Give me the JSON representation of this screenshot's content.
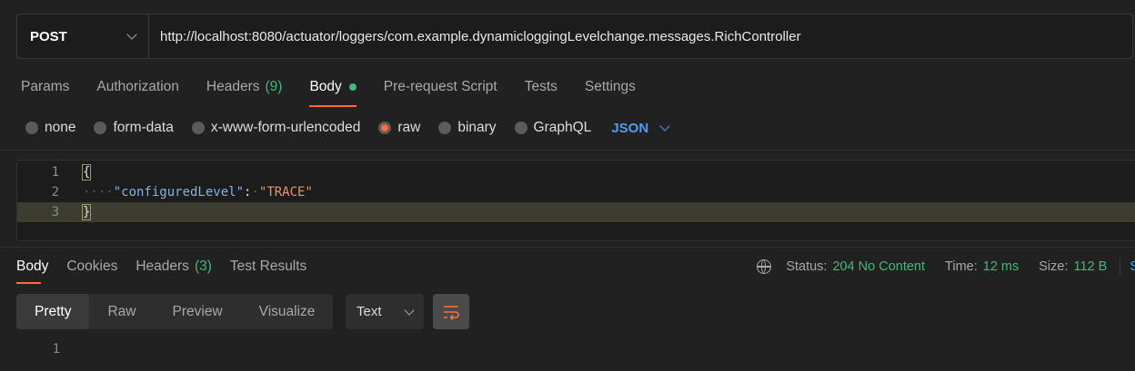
{
  "request": {
    "method": "POST",
    "url": "http://localhost:8080/actuator/loggers/com.example.dynamicloggingLevelchange.messages.RichController"
  },
  "request_tabs": [
    {
      "label": "Params"
    },
    {
      "label": "Authorization"
    },
    {
      "label": "Headers",
      "count": "(9)"
    },
    {
      "label": "Body",
      "active": true
    },
    {
      "label": "Pre-request Script"
    },
    {
      "label": "Tests"
    },
    {
      "label": "Settings"
    }
  ],
  "body_types": [
    "none",
    "form-data",
    "x-www-form-urlencoded",
    "raw",
    "binary",
    "GraphQL"
  ],
  "body_language": "JSON",
  "editor": {
    "lines": [
      {
        "num": "1",
        "text": "{"
      },
      {
        "num": "2",
        "key": "\"configuredLevel\"",
        "colon": ":",
        "value": "\"TRACE\""
      },
      {
        "num": "3",
        "text": "}"
      }
    ]
  },
  "response_tabs": [
    {
      "label": "Body"
    },
    {
      "label": "Cookies"
    },
    {
      "label": "Headers",
      "count": "(3)"
    },
    {
      "label": "Test Results"
    }
  ],
  "status": {
    "status_label": "Status:",
    "status_value": "204 No Content",
    "time_label": "Time:",
    "time_value": "12 ms",
    "size_label": "Size:",
    "size_value": "112 B",
    "edge_glyph": "S"
  },
  "view_tabs": [
    "Pretty",
    "Raw",
    "Preview",
    "Visualize"
  ],
  "format_select": "Text",
  "response_body": {
    "line_num": "1"
  },
  "colors": {
    "accent": "#ff6c37",
    "green": "#3fb978",
    "link_blue": "#4c9ef5"
  }
}
